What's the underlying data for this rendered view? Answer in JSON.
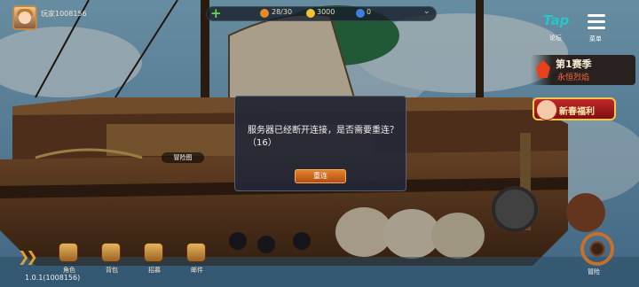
{
  "player": {
    "name": "玩家1008156",
    "sub_label": ""
  },
  "resources": {
    "energy": "28/30",
    "gold": "3000",
    "gems": "0"
  },
  "buttons": {
    "tap_logo": "Tap",
    "tap_label": "论坛",
    "menu_label": "菜单",
    "season_title": "第1赛季",
    "season_sub": "永恒烈焰",
    "new_year": "新春福利",
    "voyage": "冒险"
  },
  "scene_labels": {
    "adventure_tag": "冒险图"
  },
  "bottom_nav": {
    "items": [
      {
        "label": "角色"
      },
      {
        "label": "背包"
      },
      {
        "label": "招募"
      },
      {
        "label": "邮件"
      }
    ]
  },
  "version": "1.0.1(1008156)",
  "dialog": {
    "message": "服务器已经断开连接，是否需要重连？（16）",
    "reconnect_label": "重连"
  },
  "colors": {
    "sky": "#7fb6d8",
    "accent_orange": "#e2832c",
    "tap_teal": "#26c6c6",
    "season_red": "#ff6a3a"
  }
}
